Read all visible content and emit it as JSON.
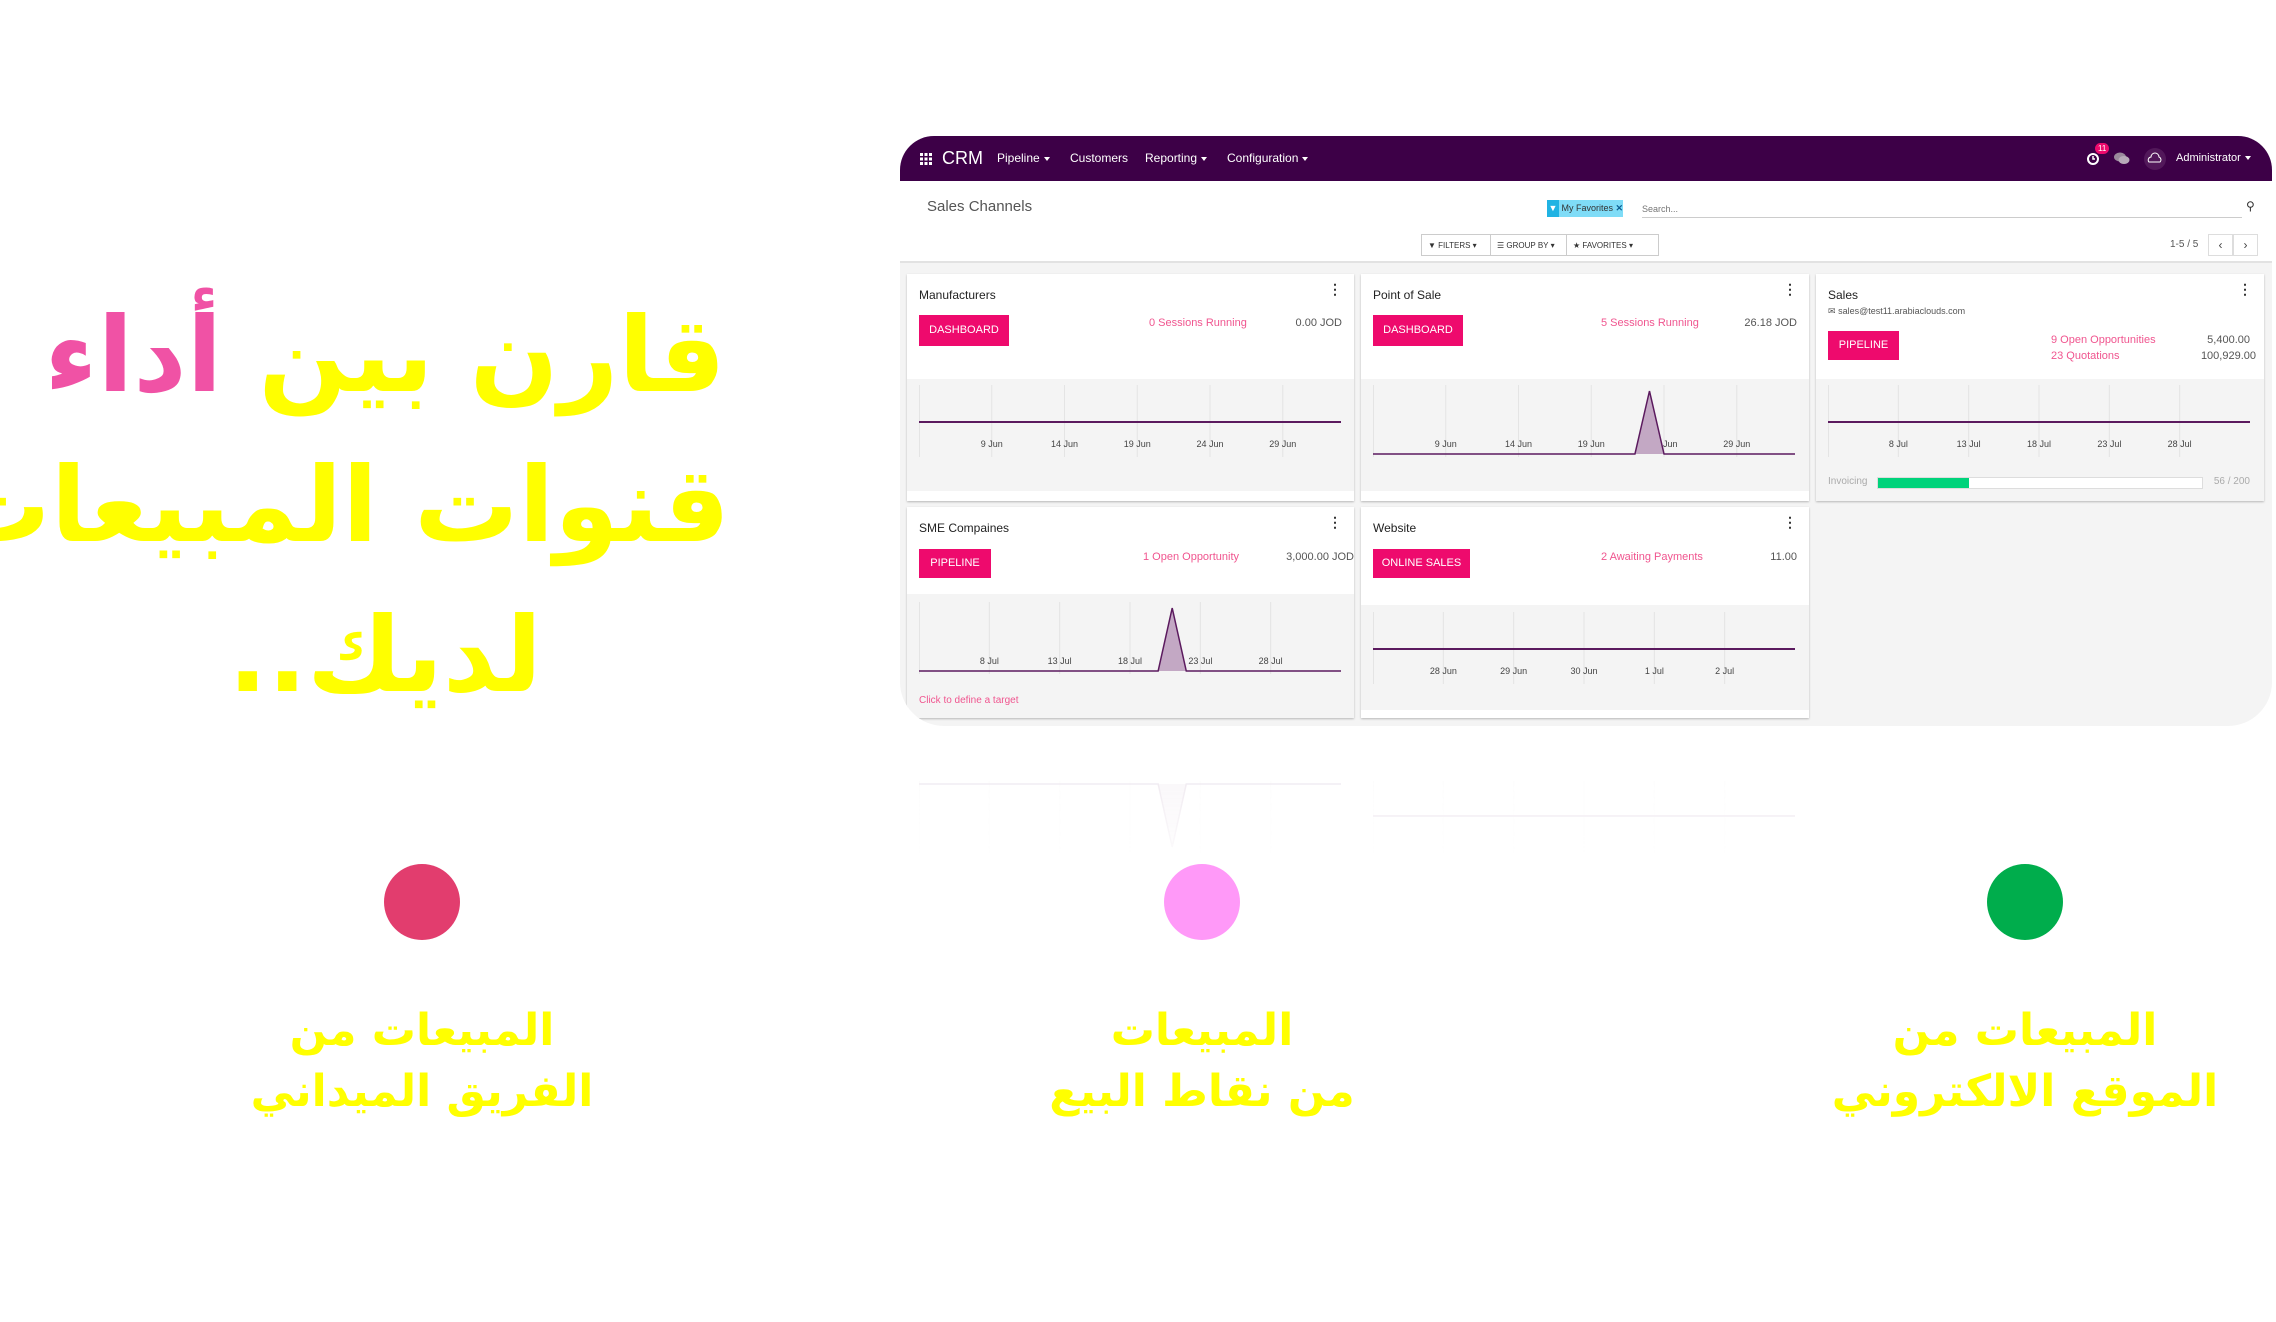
{
  "headline": {
    "line1_a": "قارن بين ",
    "line1_b": "أداء",
    "line2": "قنوات المبيعات",
    "line3": "لديك.."
  },
  "features": [
    {
      "line1": "المبيعات من",
      "line2": "الفريق الميداني",
      "color": "#e23d6e"
    },
    {
      "line1": "المبيعات",
      "line2": "من نقاط البيع",
      "color": "#ff99f8"
    },
    {
      "line1": "المبيعات من",
      "line2": "الموقع الالكتروني",
      "color": "#00ad4c"
    }
  ],
  "colors": {
    "navbar": "#3d0047",
    "accent": "#ee0a6d",
    "link": "#f0558f",
    "chart_line": "#5b1a5e",
    "chart_fill": "#c3a8c4",
    "progress": "#00d37b",
    "facet": "#7fdcf7"
  },
  "nav": {
    "app_icon": "grid-icon",
    "app": "CRM",
    "menu": [
      "Pipeline",
      "Customers",
      "Reporting",
      "Configuration"
    ],
    "activity_badge": "11",
    "user": "Administrator"
  },
  "control": {
    "title": "Sales Channels",
    "facet": "My Favorites",
    "search_placeholder": "Search...",
    "filters": "FILTERS",
    "groupby": "GROUP BY",
    "favorites": "FAVORITES",
    "pager": "1-5 / 5"
  },
  "cards": [
    {
      "title": "Manufacturers",
      "button": "Dashboard",
      "stat": "0 Sessions Running",
      "value": "0.00 JOD"
    },
    {
      "title": "Point of Sale",
      "button": "Dashboard",
      "stat": "5 Sessions Running",
      "value": "26.18 JOD"
    },
    {
      "title": "Sales",
      "email": "sales@test11.arabiaclouds.com",
      "button": "Pipeline",
      "stats": [
        {
          "label": "9 Open Opportunities",
          "value": "5,400.00"
        },
        {
          "label": "23 Quotations",
          "value": "100,929.00"
        }
      ],
      "invoicing": {
        "label": "Invoicing",
        "current": 56,
        "target": 200,
        "text": "56 / 200"
      }
    },
    {
      "title": "SME Compaines",
      "button": "Pipeline",
      "stat": "1 Open Opportunity",
      "value": "3,000.00 JOD",
      "link": "Click to define a target"
    },
    {
      "title": "Website",
      "button": "Online Sales",
      "stat": "2 Awaiting Payments",
      "value": "11.00"
    }
  ],
  "chart_data": [
    {
      "type": "area",
      "range": [
        "4 Jun",
        "3 Jul"
      ],
      "ticks": [
        "9 Jun",
        "14 Jun",
        "19 Jun",
        "24 Jun",
        "29 Jun"
      ],
      "points": [
        {
          "x": "4 Jun",
          "y": 0
        },
        {
          "x": "3 Jul",
          "y": 0
        }
      ]
    },
    {
      "type": "area",
      "range": [
        "4 Jun",
        "3 Jul"
      ],
      "ticks": [
        "9 Jun",
        "14 Jun",
        "19 Jun",
        "24 Jun",
        "29 Jun"
      ],
      "points": [
        {
          "x": "4 Jun",
          "y": 0
        },
        {
          "x": "22 Jun",
          "y": 0
        },
        {
          "x": "23 Jun",
          "y": 1
        },
        {
          "x": "24 Jun",
          "y": 0
        },
        {
          "x": "3 Jul",
          "y": 0
        }
      ]
    },
    {
      "type": "area",
      "range": [
        "3 Jul",
        "2 Aug"
      ],
      "ticks": [
        "8 Jul",
        "13 Jul",
        "18 Jul",
        "23 Jul",
        "28 Jul"
      ],
      "points": [
        {
          "x": "3 Jul",
          "y": 0
        },
        {
          "x": "2 Aug",
          "y": 0
        }
      ]
    },
    {
      "type": "area",
      "range": [
        "3 Jul",
        "2 Aug"
      ],
      "ticks": [
        "8 Jul",
        "13 Jul",
        "18 Jul",
        "23 Jul",
        "28 Jul"
      ],
      "points": [
        {
          "x": "3 Jul",
          "y": 0
        },
        {
          "x": "20 Jul",
          "y": 0
        },
        {
          "x": "21 Jul",
          "y": 1
        },
        {
          "x": "22 Jul",
          "y": 0
        },
        {
          "x": "2 Aug",
          "y": 0
        }
      ]
    },
    {
      "type": "area",
      "range": [
        "27 Jun",
        "3 Jul"
      ],
      "ticks": [
        "28 Jun",
        "29 Jun",
        "30 Jun",
        "1 Jul",
        "2 Jul"
      ],
      "points": [
        {
          "x": "27 Jun",
          "y": 0
        },
        {
          "x": "3 Jul",
          "y": 0
        }
      ]
    }
  ]
}
